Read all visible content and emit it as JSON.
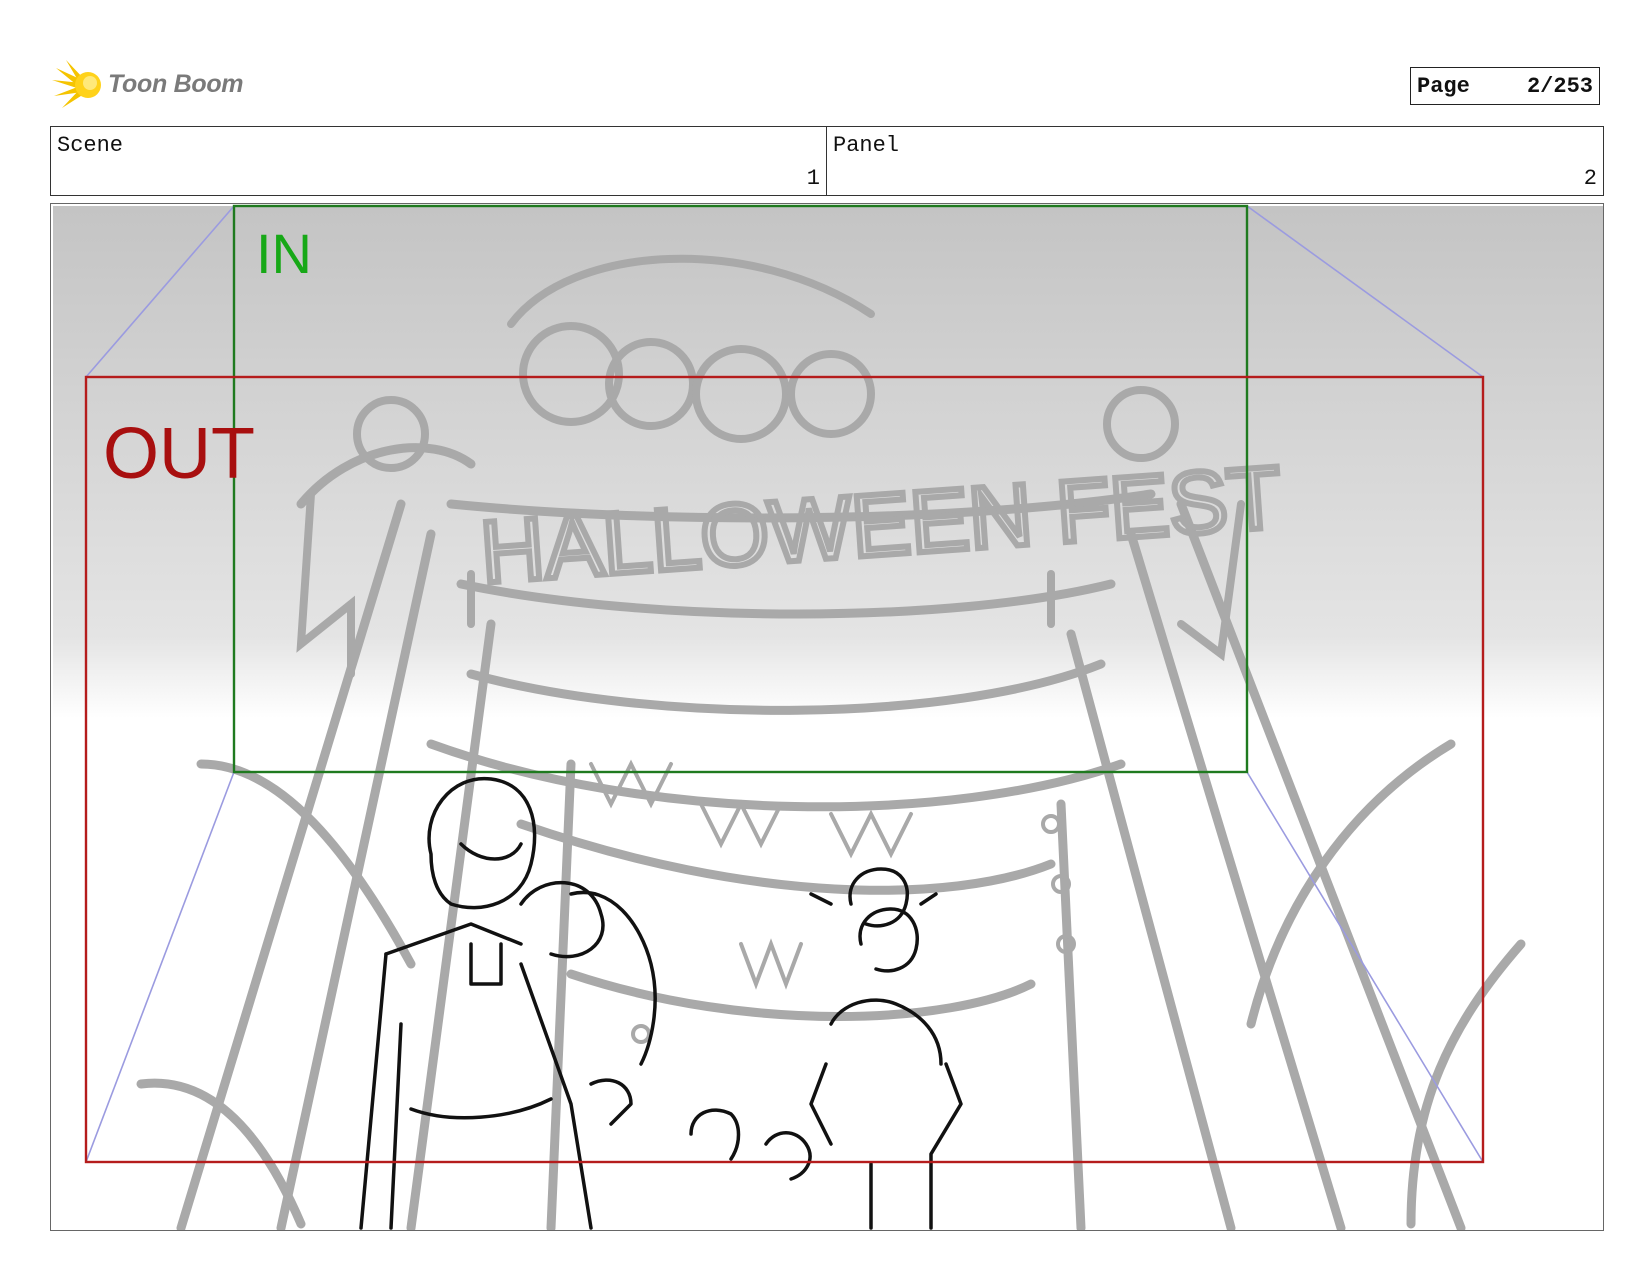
{
  "header": {
    "logo_text": "Toon Boom",
    "logo_icon": "starburst-icon",
    "page_label": "Page",
    "page_value": "2/253"
  },
  "info": {
    "scene_label": "Scene",
    "scene_value": "1",
    "panel_label": "Panel",
    "panel_value": "2"
  },
  "camera": {
    "in_label": "IN",
    "out_label": "OUT",
    "in_color": "#17a817",
    "out_color": "#a80f0f",
    "guide_color": "#9b9be0"
  },
  "drawing": {
    "banner_text": "HALLOWEEN FEST"
  }
}
